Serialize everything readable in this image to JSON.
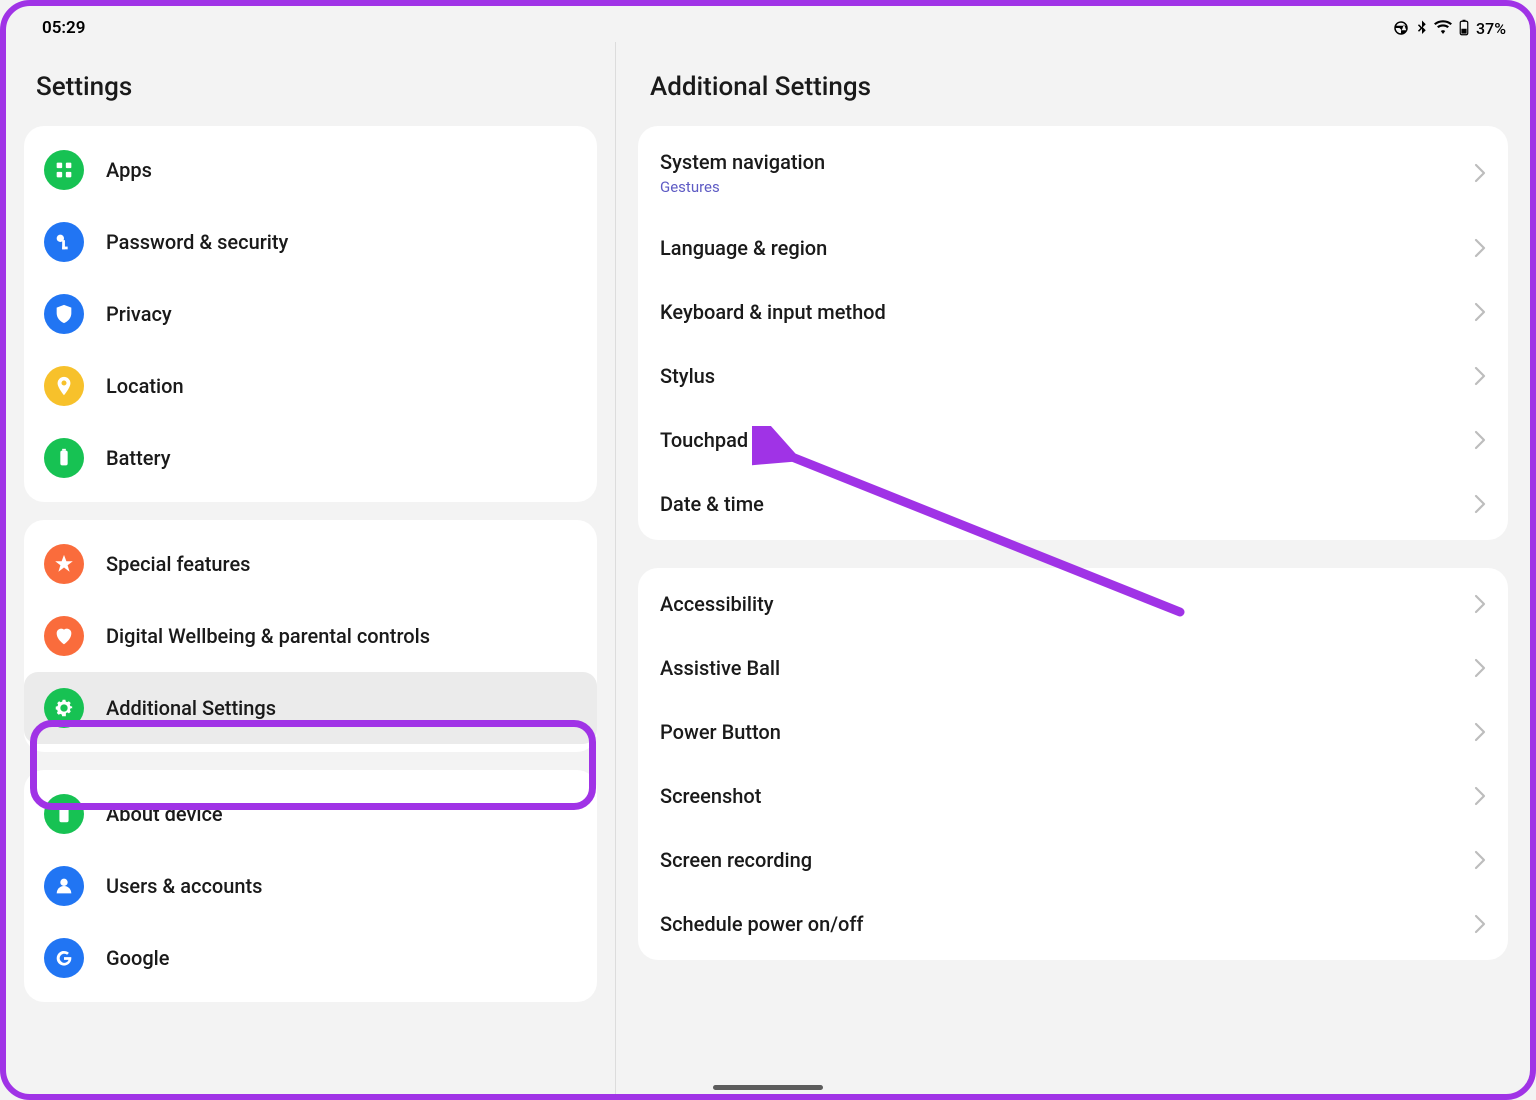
{
  "status_bar": {
    "time": "05:29",
    "battery_pct": "37%"
  },
  "sidebar": {
    "title": "Settings",
    "groups": [
      {
        "items": [
          {
            "label": "Apps",
            "icon": "apps",
            "color": "#17c253"
          },
          {
            "label": "Password & security",
            "icon": "key",
            "color": "#2175f3"
          },
          {
            "label": "Privacy",
            "icon": "shield",
            "color": "#2175f3"
          },
          {
            "label": "Location",
            "icon": "location",
            "color": "#f7c12b"
          },
          {
            "label": "Battery",
            "icon": "battery",
            "color": "#17c253"
          }
        ]
      },
      {
        "items": [
          {
            "label": "Special features",
            "icon": "star",
            "color": "#fa6c3c"
          },
          {
            "label": "Digital Wellbeing & parental controls",
            "icon": "heart",
            "color": "#fa6c3c"
          },
          {
            "label": "Additional Settings",
            "icon": "gear",
            "color": "#17c253",
            "selected": true,
            "highlighted": true
          }
        ]
      },
      {
        "items": [
          {
            "label": "About device",
            "icon": "phone",
            "color": "#17c253"
          },
          {
            "label": "Users & accounts",
            "icon": "person",
            "color": "#2175f3"
          },
          {
            "label": "Google",
            "icon": "google",
            "color": "#2175f3"
          }
        ]
      }
    ]
  },
  "detail": {
    "title": "Additional Settings",
    "groups": [
      {
        "rows": [
          {
            "label": "System navigation",
            "sublabel": "Gestures"
          },
          {
            "label": "Language & region"
          },
          {
            "label": "Keyboard & input method"
          },
          {
            "label": "Stylus",
            "arrow_target": true
          },
          {
            "label": "Touchpad"
          },
          {
            "label": "Date & time"
          }
        ]
      },
      {
        "rows": [
          {
            "label": "Accessibility"
          },
          {
            "label": "Assistive Ball"
          },
          {
            "label": "Power Button"
          },
          {
            "label": "Screenshot"
          },
          {
            "label": "Screen recording"
          },
          {
            "label": "Schedule power on/off"
          }
        ]
      }
    ]
  }
}
